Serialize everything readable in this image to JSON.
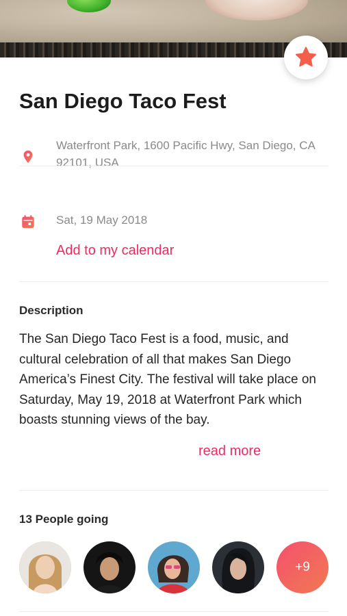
{
  "event": {
    "title": "San Diego Taco Fest",
    "favorite_icon": "star-icon",
    "location": {
      "icon": "location-pin-icon",
      "address": "Waterfront Park, 1600 Pacific Hwy, San Diego, CA 92101, USA"
    },
    "date": {
      "icon": "calendar-icon",
      "value": "Sat, 19 May 2018",
      "add_to_calendar_label": "Add to my calendar"
    }
  },
  "description": {
    "heading": "Description",
    "text": "The San Diego Taco Fest is a food, music, and cultural celebration of all that makes San Diego America’s Finest City. The festival will take place on Saturday, May 19, 2018 at Waterfront Park which boasts stunning views of the bay.",
    "read_more_label": "read more"
  },
  "attendees": {
    "heading": "13 People going",
    "more_count_label": "+9"
  },
  "colors": {
    "accent": "#f2295f",
    "star": "#f25f4a",
    "divider": "#ececec"
  }
}
